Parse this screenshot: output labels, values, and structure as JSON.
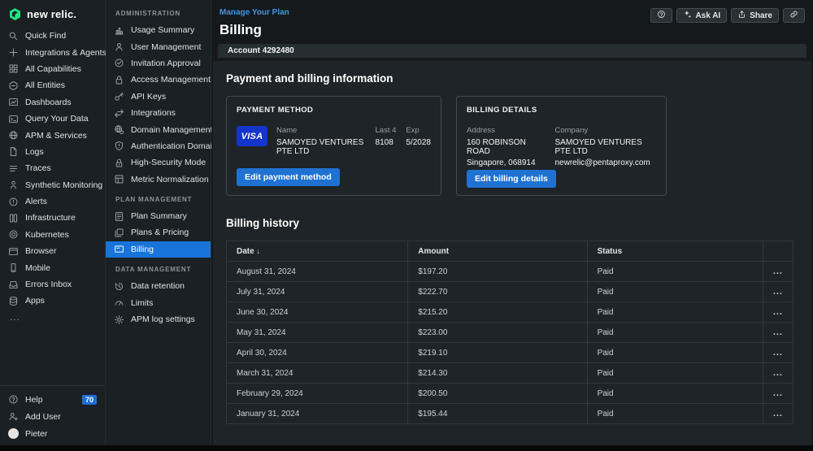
{
  "brand": {
    "logo_text": "new relic.",
    "logo_color": "#1ce783"
  },
  "global_nav": {
    "items": [
      {
        "icon": "search",
        "label": "Quick Find"
      },
      {
        "icon": "plus",
        "label": "Integrations & Agents"
      },
      {
        "icon": "grid",
        "label": "All Capabilities"
      },
      {
        "icon": "hexagon",
        "label": "All Entities"
      },
      {
        "icon": "dashboard",
        "label": "Dashboards"
      },
      {
        "icon": "terminal",
        "label": "Query Your Data"
      },
      {
        "icon": "globe",
        "label": "APM & Services"
      },
      {
        "icon": "document",
        "label": "Logs"
      },
      {
        "icon": "list",
        "label": "Traces"
      },
      {
        "icon": "person",
        "label": "Synthetic Monitoring"
      },
      {
        "icon": "alert-circle",
        "label": "Alerts"
      },
      {
        "icon": "infrastructure",
        "label": "Infrastructure"
      },
      {
        "icon": "kubernetes",
        "label": "Kubernetes"
      },
      {
        "icon": "browser",
        "label": "Browser"
      },
      {
        "icon": "mobile",
        "label": "Mobile"
      },
      {
        "icon": "inbox",
        "label": "Errors Inbox"
      },
      {
        "icon": "stack",
        "label": "Apps"
      }
    ],
    "overflow_label": "...",
    "footer": [
      {
        "icon": "help-circle",
        "label": "Help",
        "badge": "70"
      },
      {
        "icon": "add-user",
        "label": "Add User"
      },
      {
        "icon": "avatar",
        "label": "Pieter"
      }
    ]
  },
  "settings_nav": {
    "sections": [
      {
        "title": "ADMINISTRATION",
        "items": [
          {
            "icon": "bar-chart",
            "label": "Usage Summary"
          },
          {
            "icon": "user",
            "label": "User Management"
          },
          {
            "icon": "check-circle",
            "label": "Invitation Approval"
          },
          {
            "icon": "lock",
            "label": "Access Management"
          },
          {
            "icon": "key",
            "label": "API Keys"
          },
          {
            "icon": "arrows",
            "label": "Integrations"
          },
          {
            "icon": "globe-gear",
            "label": "Domain Management"
          },
          {
            "icon": "shield",
            "label": "Authentication Domains"
          },
          {
            "icon": "padlock",
            "label": "High-Security Mode"
          },
          {
            "icon": "metric",
            "label": "Metric Normalization"
          }
        ]
      },
      {
        "title": "PLAN MANAGEMENT",
        "items": [
          {
            "icon": "plan",
            "label": "Plan Summary"
          },
          {
            "icon": "layers",
            "label": "Plans & Pricing"
          },
          {
            "icon": "billing-card",
            "label": "Billing",
            "selected": true
          }
        ]
      },
      {
        "title": "DATA MANAGEMENT",
        "items": [
          {
            "icon": "clock",
            "label": "Data retention"
          },
          {
            "icon": "gauge",
            "label": "Limits"
          },
          {
            "icon": "gear",
            "label": "APM log settings"
          }
        ]
      }
    ]
  },
  "header": {
    "breadcrumb": "Manage Your Plan",
    "title": "Billing",
    "actions": [
      {
        "icon": "help-circle",
        "label": ""
      },
      {
        "icon": "sparkle",
        "label": "Ask AI"
      },
      {
        "icon": "share",
        "label": "Share"
      },
      {
        "icon": "link",
        "label": ""
      }
    ]
  },
  "account_bar": {
    "label": "Account 4292480"
  },
  "payment_section": {
    "title": "Payment and billing information",
    "payment_method": {
      "card_title": "PAYMENT METHOD",
      "card_brand": "VISA",
      "name_label": "Name",
      "name_value": "SAMOYED VENTURES PTE LTD",
      "last4_label": "Last 4",
      "last4_value": "8108",
      "exp_label": "Exp",
      "exp_value": "5/2028",
      "edit_button": "Edit payment method"
    },
    "billing_details": {
      "card_title": "BILLING DETAILS",
      "address_label": "Address",
      "address_line1": "160 ROBINSON ROAD",
      "address_line2": "Singapore, 068914",
      "company_label": "Company",
      "company_name": "SAMOYED VENTURES PTE LTD",
      "company_email": "newrelic@pentaproxy.com",
      "edit_button": "Edit billing details"
    }
  },
  "billing_history": {
    "title": "Billing history",
    "columns": [
      "Date",
      "Amount",
      "Status"
    ],
    "sorted_by": "Date",
    "sort_direction": "desc",
    "row_menu_glyph": "...",
    "rows": [
      {
        "date": "August 31, 2024",
        "amount": "$197.20",
        "status": "Paid"
      },
      {
        "date": "July 31, 2024",
        "amount": "$222.70",
        "status": "Paid"
      },
      {
        "date": "June 30, 2024",
        "amount": "$215.20",
        "status": "Paid"
      },
      {
        "date": "May 31, 2024",
        "amount": "$223.00",
        "status": "Paid"
      },
      {
        "date": "April 30, 2024",
        "amount": "$219.10",
        "status": "Paid"
      },
      {
        "date": "March 31, 2024",
        "amount": "$214.30",
        "status": "Paid"
      },
      {
        "date": "February 29, 2024",
        "amount": "$200.50",
        "status": "Paid"
      },
      {
        "date": "January 31, 2024",
        "amount": "$195.44",
        "status": "Paid"
      }
    ]
  },
  "colors": {
    "accent_blue": "#1f72d2",
    "selected_blue": "#1874d9",
    "link_blue": "#3e96e8",
    "brand_green": "#1ce783",
    "visa_blue": "#1434cb"
  }
}
